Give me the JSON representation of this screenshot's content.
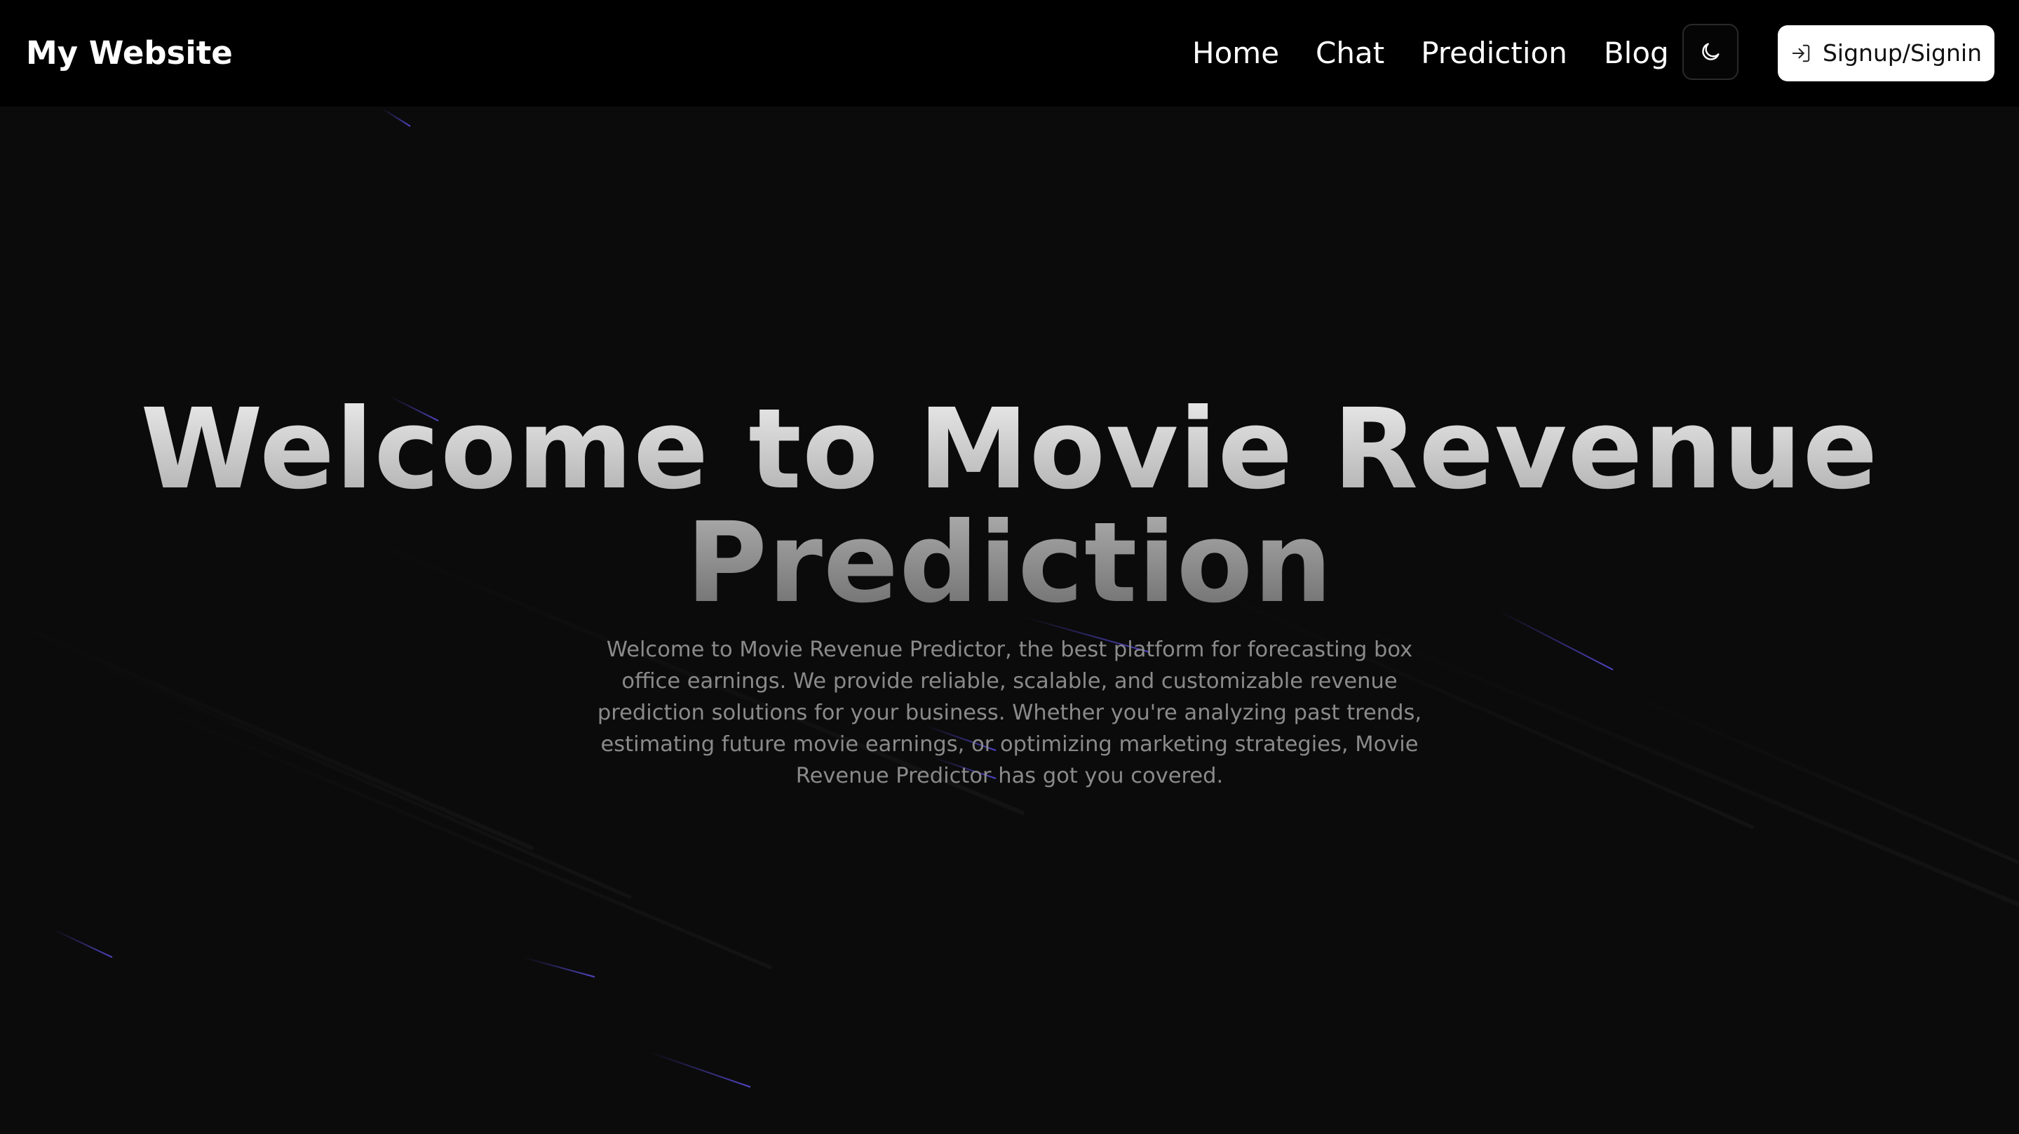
{
  "navbar": {
    "brand": "My Website",
    "links": [
      {
        "label": "Home"
      },
      {
        "label": "Chat"
      },
      {
        "label": "Prediction"
      },
      {
        "label": "Blog"
      }
    ],
    "theme_toggle_icon": "moon-icon",
    "signin": {
      "label": "Signup/Signin",
      "icon": "sign-in-icon"
    }
  },
  "hero": {
    "title": "Welcome to Movie Revenue Prediction",
    "description": "Welcome to Movie Revenue Predictor, the best platform for forecasting box office earnings. We provide reliable, scalable, and customizable revenue prediction solutions for your business. Whether you're analyzing past trends, estimating future movie earnings, or optimizing marketing strategies, Movie Revenue Predictor has got you covered."
  },
  "colors": {
    "navbar_bg": "#000000",
    "page_bg": "#0b0b0b",
    "streak": "#4b3fbf",
    "description_text": "#8a8a8a"
  }
}
